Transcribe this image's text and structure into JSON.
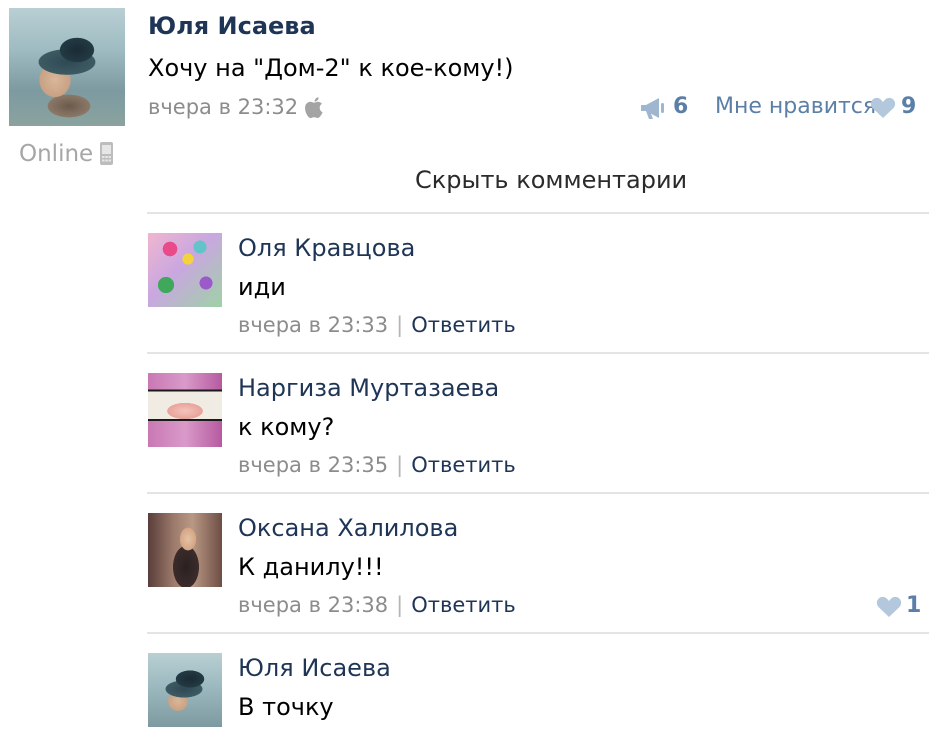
{
  "post": {
    "author": "Юля Исаева",
    "text": "Хочу на \"Дом-2\" к кое-кому!)",
    "time": "вчера в 23:32",
    "device_icon": "apple-icon",
    "online": "Online",
    "online_device_icon": "phone-icon",
    "repost_icon": "megaphone-icon",
    "repost_count": "6",
    "like_label": "Мне нравится",
    "like_icon": "heart-icon",
    "like_count": "9"
  },
  "hide_comments_label": "Скрыть комментарии",
  "comments": [
    {
      "author": "Оля Кравцова",
      "text": "иди",
      "time": "вчера в 23:33",
      "separator": "|",
      "reply_label": "Ответить"
    },
    {
      "author": "Наргиза Муртазаева",
      "text": "к кому?",
      "time": "вчера в 23:35",
      "separator": "|",
      "reply_label": "Ответить"
    },
    {
      "author": "Оксана Халилова",
      "text": "К данилу!!!",
      "time": "вчера в 23:38",
      "separator": "|",
      "reply_label": "Ответить",
      "like_count": "1"
    },
    {
      "author": "Юля Исаева",
      "text": "В точку"
    }
  ],
  "colors": {
    "author_name": "#1f3556",
    "link": "#5b7fa6",
    "meta_gray": "#8c8c8c",
    "divider": "#e4e4e4"
  }
}
